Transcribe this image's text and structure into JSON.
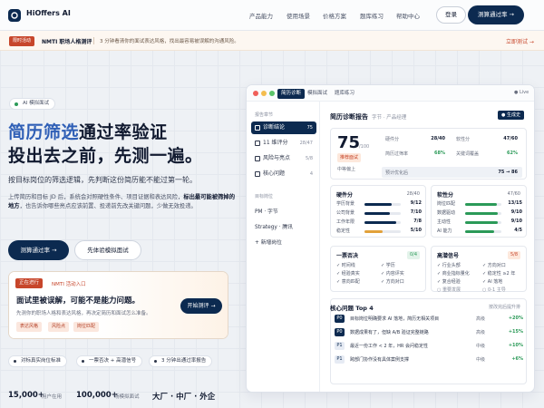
{
  "nav": {
    "brand": "HiOffers AI",
    "links": [
      "产品能力",
      "使用场景",
      "价格方案",
      "题库练习",
      "帮助中心"
    ],
    "login": "登录",
    "test": "测算通过率 →"
  },
  "banner": {
    "tag": "限时活动",
    "title": "NMTI 职场人格测评",
    "desc": "3 分钟看清你的面试表达风格，找出最容易被误解的沟通风险。",
    "link": "立即测试 →"
  },
  "hero": {
    "pill": "AI 模拟面试",
    "h1_hl": "简历筛选",
    "h1_rest": "通过率验证",
    "h1_line2": "投出去之前，先测一遍。",
    "sub": "按目标岗位的筛选逻辑，先判断这份简历能不能过第一轮。",
    "para1": "上传简历和目标 JD 后，系统会对照硬性条件、项目证据和表达风险，",
    "para_bold": "标出最可能被筛掉的地方",
    "para2": "，也告诉你哪些亮点应该前置、投递前先改关键问题，少做无效投递。",
    "cta1": "测算通过率 →",
    "cta2": "先体验模拟面试"
  },
  "promo": {
    "tag": "正在进行",
    "label": "NMTI 活动入口",
    "title": "面试里被误解，可能不是能力问题。",
    "desc": "先测你的职场人格和表达风格，再决定简历和面试怎么准备。",
    "chips": [
      "表达风格",
      "风险点",
      "岗位匹配"
    ],
    "button": "开始测评 →"
  },
  "checks": [
    "对标真实岗位标准",
    "一票否决 + 高潜信号",
    "3 分钟出通过率报告"
  ],
  "stats": [
    {
      "n": "15,000+",
      "l": "用户在用"
    },
    {
      "n": "100,000+",
      "l": "场模拟面试"
    },
    {
      "n": "大厂 · 中厂 · 外企",
      "l": ""
    }
  ],
  "app": {
    "tabs": [
      "简历诊断",
      "模拟面试",
      "题库练习"
    ],
    "live": "● Live",
    "side_head1": "报告章节",
    "side_items": [
      {
        "label": "诊断结论",
        "n": "75"
      },
      {
        "label": "11 维评分",
        "n": "28/47"
      },
      {
        "label": "风险与亮点",
        "n": "5/8"
      },
      {
        "label": "核心问题",
        "n": "4"
      }
    ],
    "side_head2": "目标岗位",
    "side_jobs": [
      "PM · 字节",
      "Strategy · 腾讯",
      "+ 新增岗位"
    ],
    "report_title": "简历诊断报告",
    "report_sub": "字节 · 产品经理",
    "report_btn": "● 生成史",
    "score": "75",
    "score_of": "/100",
    "grade": "推荐面试",
    "grade_lbl": "中等偏上",
    "kvs": [
      {
        "k": "硬件分",
        "v": "28/40"
      },
      {
        "k": "软性分",
        "v": "47/60"
      },
      {
        "k": "简历过筛率",
        "v": "68%"
      },
      {
        "k": "关键词覆盖",
        "v": "62%"
      }
    ],
    "pred_k": "预计优化后",
    "pred_v": "75 → 86",
    "hard": {
      "title": "硬件分",
      "score": "28/40",
      "rows": [
        {
          "k": "学历背景",
          "v": "9/12"
        },
        {
          "k": "公司背景",
          "v": "7/10"
        },
        {
          "k": "工作年限",
          "v": "7/8"
        },
        {
          "k": "稳定性",
          "v": "5/10"
        }
      ]
    },
    "soft": {
      "title": "软性分",
      "score": "47/60",
      "rows": [
        {
          "k": "岗位匹配",
          "v": "13/15"
        },
        {
          "k": "数据驱动",
          "v": "9/10"
        },
        {
          "k": "主动性",
          "v": "9/10"
        },
        {
          "k": "AI 能力",
          "v": "4/5"
        }
      ]
    },
    "veto": {
      "title": "一票否决",
      "badge": "0/4",
      "items": [
        "时间线",
        "学历",
        "经验真实",
        "内容评实",
        "意向匹配",
        "方向对口"
      ]
    },
    "hipo": {
      "title": "高潜信号",
      "badge": "5/8",
      "items": [
        "行业头部",
        "方向对口",
        "商业指标量化",
        "稳定性 ≥2 年",
        "复合经验",
        "AI 落地",
        "重要发展",
        "0-1 主导"
      ]
    },
    "issues_title": "核心问题 Top 4",
    "issues_right": "按改完后提升排",
    "issues": [
      {
        "p": "P0",
        "t": "目标岗位明确要求 AI 落地，简历无相关项目",
        "lv": "高级",
        "d": "+20%"
      },
      {
        "p": "P0",
        "t": "数据成果有了，但缺 A/B 验证完整链路",
        "lv": "高级",
        "d": "+15%"
      },
      {
        "p": "P1",
        "t": "最近一份工作 < 2 年，HR 会问稳定性",
        "lv": "中级",
        "d": "+10%"
      },
      {
        "p": "P1",
        "t": "跨部门协作没有具体案例支撑",
        "lv": "中级",
        "d": "+6%"
      }
    ]
  }
}
